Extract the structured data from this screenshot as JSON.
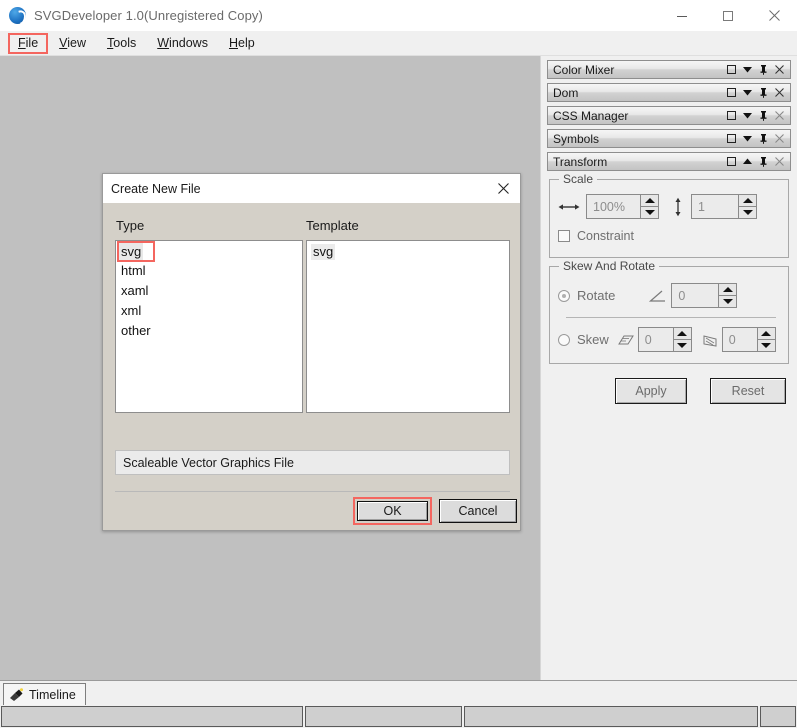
{
  "window": {
    "title": "SVGDeveloper 1.0(Unregistered Copy)",
    "icon": "app-logo-icon",
    "controls": [
      {
        "name": "minimize-button",
        "glyph": "minimize-icon"
      },
      {
        "name": "maximize-button",
        "glyph": "maximize-icon"
      },
      {
        "name": "close-button",
        "glyph": "close-icon"
      }
    ]
  },
  "menubar": {
    "items": [
      {
        "label": "File",
        "accel": "F",
        "highlighted": true
      },
      {
        "label": "View",
        "accel": "V",
        "highlighted": false
      },
      {
        "label": "Tools",
        "accel": "T",
        "highlighted": false
      },
      {
        "label": "Windows",
        "accel": "W",
        "highlighted": false
      },
      {
        "label": "Help",
        "accel": "H",
        "highlighted": false
      }
    ]
  },
  "dock": {
    "panels": [
      {
        "title": "Color Mixer",
        "collapsed": true,
        "chevron": "chevron-down-icon"
      },
      {
        "title": "Dom",
        "collapsed": true,
        "chevron": "chevron-down-icon"
      },
      {
        "title": "CSS Manager",
        "collapsed": true,
        "chevron": "chevron-down-icon"
      },
      {
        "title": "Symbols",
        "collapsed": true,
        "chevron": "chevron-down-icon"
      },
      {
        "title": "Transform",
        "collapsed": false,
        "chevron": "chevron-up-icon"
      }
    ],
    "panel_buttons": [
      "maximize-icon",
      "chevron-icon",
      "pin-icon",
      "close-icon"
    ]
  },
  "transform": {
    "scale": {
      "legend": "Scale",
      "horizontal_icon": "horizontal-arrows-icon",
      "horizontal_value": "100%",
      "vertical_icon": "vertical-arrows-icon",
      "vertical_value": "1",
      "constraint_label": "Constraint",
      "constraint_checked": false
    },
    "skew_rotate": {
      "legend": "Skew And Rotate",
      "rotate_label": "Rotate",
      "rotate_selected": true,
      "rotate_icon": "angle-icon",
      "rotate_value": "0",
      "skew_label": "Skew",
      "skew_selected": false,
      "skew_x_icon": "skew-horizontal-icon",
      "skew_x_value": "0",
      "skew_y_icon": "skew-vertical-icon",
      "skew_y_value": "0"
    },
    "apply_label": "Apply",
    "reset_label": "Reset"
  },
  "dialog": {
    "title": "Create New File",
    "close_icon": "close-icon",
    "type_header": "Type",
    "template_header": "Template",
    "type_items": [
      {
        "label": "svg",
        "selected": true,
        "highlighted": true
      },
      {
        "label": "html",
        "selected": false,
        "highlighted": false
      },
      {
        "label": "xaml",
        "selected": false,
        "highlighted": false
      },
      {
        "label": "xml",
        "selected": false,
        "highlighted": false
      },
      {
        "label": "other",
        "selected": false,
        "highlighted": false
      }
    ],
    "template_items": [
      {
        "label": "svg",
        "selected": true
      }
    ],
    "description": "Scaleable Vector Graphics File",
    "ok_label": "OK",
    "ok_highlighted": true,
    "cancel_label": "Cancel"
  },
  "bottom": {
    "timeline_tab": "Timeline",
    "timeline_icon": "timeline-icon",
    "status_cells": [
      "",
      "",
      "",
      ""
    ]
  },
  "colors": {
    "highlight": "#f4665f",
    "workspace": "#c0c0c0",
    "chrome": "#f0f0f0",
    "dialog_bg": "#d4d0c8"
  }
}
